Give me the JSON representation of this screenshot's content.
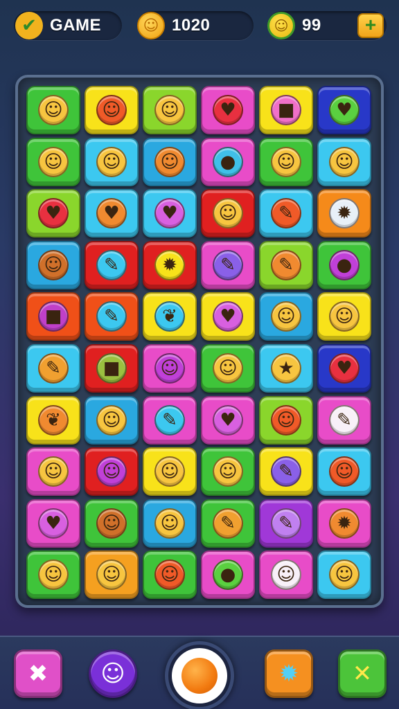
{
  "topbar": {
    "game_label": "GAME",
    "game_icon": "check-icon",
    "score": "1020",
    "score_icon": "coin-icon",
    "lives": "99",
    "lives_icon": "sun-badge-icon",
    "plus_label": "+"
  },
  "board": {
    "rows": 10,
    "cols": 6,
    "tiles": [
      [
        {
          "c": "#3fc43a",
          "s": "#f7c540",
          "g": "☺",
          "n": "cat-face"
        },
        {
          "c": "#f8e21a",
          "s": "#f05a28",
          "g": "☺",
          "n": "cat-face"
        },
        {
          "c": "#8ad62c",
          "s": "#f7c540",
          "g": "☺",
          "n": "smiley-face"
        },
        {
          "c": "#e84cc8",
          "s": "#e83040",
          "g": "♥",
          "n": "heart"
        },
        {
          "c": "#f8e21a",
          "s": "#f070c8",
          "g": "■",
          "n": "box"
        },
        {
          "c": "#2838c8",
          "s": "#5ad040",
          "g": "♥",
          "n": "heart-key"
        }
      ],
      [
        {
          "c": "#3fc43a",
          "s": "#f7c540",
          "g": "☺",
          "n": "cat-face"
        },
        {
          "c": "#3cc8f0",
          "s": "#f7c540",
          "g": "☺",
          "n": "cat-face"
        },
        {
          "c": "#2aa8e0",
          "s": "#f08a30",
          "g": "☺",
          "n": "smiley-face"
        },
        {
          "c": "#e84cc8",
          "s": "#40c0e8",
          "g": "●",
          "n": "bubble"
        },
        {
          "c": "#3fc43a",
          "s": "#f7c540",
          "g": "☺",
          "n": "smiley-face"
        },
        {
          "c": "#3cc8f0",
          "s": "#f7c540",
          "g": "☺",
          "n": "smiley-face"
        }
      ],
      [
        {
          "c": "#8ad62c",
          "s": "#e83040",
          "g": "♥",
          "n": "heart"
        },
        {
          "c": "#3cc8f0",
          "s": "#f08a30",
          "g": "♥",
          "n": "heart"
        },
        {
          "c": "#3cc8f0",
          "s": "#d860e0",
          "g": "♥",
          "n": "heart"
        },
        {
          "c": "#e02020",
          "s": "#f7c540",
          "g": "☺",
          "n": "cat-face"
        },
        {
          "c": "#3cc8f0",
          "s": "#f05a28",
          "g": "✎",
          "n": "pencil"
        },
        {
          "c": "#f58a1a",
          "s": "#e8f0f8",
          "g": "✹",
          "n": "spiky-face"
        }
      ],
      [
        {
          "c": "#2aa8e0",
          "s": "#d0702a",
          "g": "☺",
          "n": "cat-face"
        },
        {
          "c": "#e02020",
          "s": "#3cc8f0",
          "g": "✎",
          "n": "pencil"
        },
        {
          "c": "#e02020",
          "s": "#f8e21a",
          "g": "✹",
          "n": "spiky-face"
        },
        {
          "c": "#e84cc8",
          "s": "#8a60e8",
          "g": "✎",
          "n": "pencil"
        },
        {
          "c": "#8ad62c",
          "s": "#f08a30",
          "g": "✎",
          "n": "pencil"
        },
        {
          "c": "#3fc43a",
          "s": "#c040d8",
          "g": "●",
          "n": "blob"
        }
      ],
      [
        {
          "c": "#f05018",
          "s": "#c040c8",
          "g": "■",
          "n": "box"
        },
        {
          "c": "#f05018",
          "s": "#3cc8f0",
          "g": "✎",
          "n": "pencil"
        },
        {
          "c": "#f8e21a",
          "s": "#3cc8f0",
          "g": "❦",
          "n": "leaf"
        },
        {
          "c": "#f8e21a",
          "s": "#d860e0",
          "g": "♥",
          "n": "heart"
        },
        {
          "c": "#2aa8e0",
          "s": "#f7c540",
          "g": "☺",
          "n": "cat-face"
        },
        {
          "c": "#f8e21a",
          "s": "#f7c540",
          "g": "☺",
          "n": "cat-face"
        }
      ],
      [
        {
          "c": "#3cc8f0",
          "s": "#f0a030",
          "g": "✎",
          "n": "pencil"
        },
        {
          "c": "#e02020",
          "s": "#9ac040",
          "g": "■",
          "n": "crate"
        },
        {
          "c": "#e84cc8",
          "s": "#c040d8",
          "g": "☺",
          "n": "smiley-face"
        },
        {
          "c": "#3fc43a",
          "s": "#f7c540",
          "g": "☺",
          "n": "smiley-face"
        },
        {
          "c": "#3cc8f0",
          "s": "#f7c540",
          "g": "★",
          "n": "star-face"
        },
        {
          "c": "#2838c8",
          "s": "#e83040",
          "g": "♥",
          "n": "apple-heart"
        }
      ],
      [
        {
          "c": "#f8e21a",
          "s": "#f08a30",
          "g": "❦",
          "n": "leaf"
        },
        {
          "c": "#2aa8e0",
          "s": "#f7c540",
          "g": "☺",
          "n": "cat-face"
        },
        {
          "c": "#e84cc8",
          "s": "#3cc8f0",
          "g": "✎",
          "n": "pin"
        },
        {
          "c": "#e84cc8",
          "s": "#d860e0",
          "g": "♥",
          "n": "heart"
        },
        {
          "c": "#8ad62c",
          "s": "#f05a28",
          "g": "☺",
          "n": "cat-face"
        },
        {
          "c": "#e84cc8",
          "s": "#f8f0f8",
          "g": "✎",
          "n": "pencil"
        }
      ],
      [
        {
          "c": "#e84cc8",
          "s": "#f7c540",
          "g": "☺",
          "n": "smiley-face"
        },
        {
          "c": "#e02020",
          "s": "#c040d8",
          "g": "☺",
          "n": "smiley-face"
        },
        {
          "c": "#f8e21a",
          "s": "#f7c540",
          "g": "☺",
          "n": "smiley-face"
        },
        {
          "c": "#3fc43a",
          "s": "#f7c540",
          "g": "☺",
          "n": "smiley-face"
        },
        {
          "c": "#f8e21a",
          "s": "#8a60e8",
          "g": "✎",
          "n": "pencil"
        },
        {
          "c": "#3cc8f0",
          "s": "#f05a28",
          "g": "☺",
          "n": "smiley-face"
        }
      ],
      [
        {
          "c": "#e84cc8",
          "s": "#d860e0",
          "g": "♥",
          "n": "heart"
        },
        {
          "c": "#3fc43a",
          "s": "#d0702a",
          "g": "☺",
          "n": "cat-face"
        },
        {
          "c": "#2aa8e0",
          "s": "#f7c540",
          "g": "☺",
          "n": "smiley-face"
        },
        {
          "c": "#3fc43a",
          "s": "#f0a030",
          "g": "✎",
          "n": "pencil"
        },
        {
          "c": "#a038d8",
          "s": "#c080f0",
          "g": "✎",
          "n": "pencil"
        },
        {
          "c": "#e84cc8",
          "s": "#f08a30",
          "g": "✹",
          "n": "spiky-face"
        }
      ],
      [
        {
          "c": "#3fc43a",
          "s": "#f7c540",
          "g": "☺",
          "n": "cat-face"
        },
        {
          "c": "#f5a020",
          "s": "#f7c540",
          "g": "☺",
          "n": "cat-face"
        },
        {
          "c": "#3fc43a",
          "s": "#f05a28",
          "g": "☺",
          "n": "cat-face"
        },
        {
          "c": "#e84cc8",
          "s": "#5ad040",
          "g": "●",
          "n": "apple"
        },
        {
          "c": "#e84cc8",
          "s": "#f8f0f8",
          "g": "☺",
          "n": "bear-face"
        },
        {
          "c": "#3cc8f0",
          "s": "#f7c540",
          "g": "☺",
          "n": "smiley-face"
        }
      ]
    ]
  },
  "bottombar": {
    "b1_glyph": "✖",
    "b1_icon": "bone-cross-icon",
    "b2_glyph": "☺",
    "b2_icon": "purple-blob-icon",
    "center_icon": "orange-orb-icon",
    "b4_glyph": "✹",
    "b4_icon": "blue-star-icon",
    "b5_glyph": "✕",
    "b5_icon": "crossed-tools-icon"
  }
}
